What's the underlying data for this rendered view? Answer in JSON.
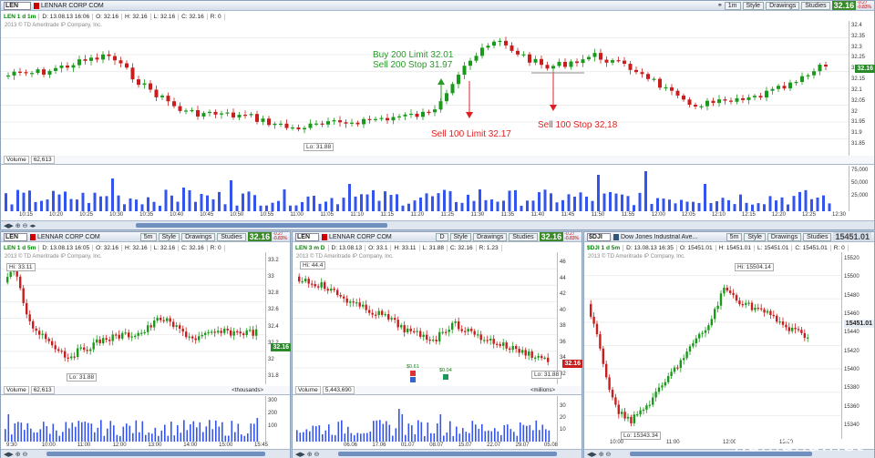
{
  "top": {
    "symbol": "LEN",
    "company": "LENNAR CORP COM",
    "interval_btn": "1m",
    "style_btn": "Style",
    "drawings_btn": "Drawings",
    "studies_btn": "Studies",
    "price": "32.16",
    "change": "-0.27",
    "change_pct": "-0.83%",
    "ohlc": [
      "LEN 1 d 1m",
      "D: 13.08.13 16:06",
      "O: 32.16",
      "H: 32.16",
      "L: 32.16",
      "C: 32.16",
      "R: 0"
    ],
    "copyright": "2013 © TD Ameritrade IP Company, Inc.",
    "yticks": [
      "32.4",
      "32.35",
      "32.3",
      "32.25",
      "32.2",
      "32.15",
      "32.1",
      "32.05",
      "32",
      "31.95",
      "31.9",
      "31.85"
    ],
    "price_label": "32.16",
    "low_label": "Lo: 31.88",
    "annotations": {
      "buy": "Buy 200 Limit 32.01",
      "sell_stop": "Sell 200 Stop 31.97",
      "sell_limit": "Sell 100 Limit 32.17",
      "sell_stop2": "Sell 100 Stop 32,18"
    },
    "volume_label": "Volume",
    "volume_value": "62,613",
    "vticks": [
      "75,000",
      "50,000",
      "25,000"
    ],
    "xticks": [
      "10:15",
      "10:20",
      "10:25",
      "10:30",
      "10:35",
      "10:40",
      "10:45",
      "10:50",
      "10:55",
      "11:00",
      "11:05",
      "11:10",
      "11:15",
      "11:20",
      "11:25",
      "11:30",
      "11:35",
      "11:40",
      "11:45",
      "11:50",
      "11:55",
      "12:00",
      "12:05",
      "12:10",
      "12:15",
      "12:20",
      "12:25",
      "12:30"
    ]
  },
  "bl": {
    "symbol": "LEN",
    "company": "LENNAR CORP COM",
    "interval_btn": "5m",
    "style_btn": "Style",
    "drawings_btn": "Drawings",
    "studies_btn": "Studies",
    "price": "32.16",
    "change": "-0.27",
    "change_pct": "-0.83%",
    "ohlc": [
      "LEN 1 d 5m",
      "D: 13.08.13 16:05",
      "O: 32.16",
      "H: 32.16",
      "L: 32.16",
      "C: 32.16",
      "R: 0"
    ],
    "copyright": "2013 © TD Ameritrade IP Company, Inc.",
    "hi_label": "Hi: 33.11",
    "lo_label": "Lo: 31.88",
    "yticks": [
      "33.2",
      "33",
      "32.8",
      "32.6",
      "32.4",
      "32.2",
      "32",
      "31.8"
    ],
    "price_label": "32.16",
    "volume_label": "Volume",
    "volume_value": "62,613",
    "volume_units": "<thousands>",
    "vticks": [
      "300",
      "200",
      "100"
    ],
    "xticks": [
      "9:30",
      "10:00",
      "11:00",
      "12:00",
      "13:00",
      "14:00",
      "15:00",
      "15:45"
    ]
  },
  "bm": {
    "symbol": "LEN",
    "company": "LENNAR CORP COM",
    "interval_btn": "D",
    "style_btn": "Style",
    "drawings_btn": "Drawings",
    "studies_btn": "Studies",
    "price": "32.16",
    "change": "-0.27",
    "change_pct": "-0.83%",
    "ohlc": [
      "LEN 3 m D",
      "D: 13.08.13",
      "O: 33.1",
      "H: 33.11",
      "L: 31.88",
      "C: 32.16",
      "R: 1.23"
    ],
    "copyright": "2013 © TD Ameritrade IP Company, Inc.",
    "hi_label": "Hi: 44.4",
    "lo_label": "Lo: 31.88",
    "div1": "$0.61",
    "div2": "$0.04",
    "yticks": [
      "46",
      "44",
      "42",
      "40",
      "38",
      "36",
      "34",
      "32"
    ],
    "price_label": "32.16",
    "volume_label": "Volume",
    "volume_value": "5,443,690",
    "volume_units": "<millions>",
    "vticks": [
      "30",
      "20",
      "10"
    ],
    "xticks": [
      "06.06",
      "17.06",
      "01.07",
      "08.07",
      "15.07",
      "22.07",
      "29.07",
      "05.08"
    ]
  },
  "br": {
    "symbol": "$DJI",
    "company": "Dow Jones Industrial Ave...",
    "interval_btn": "5m",
    "style_btn": "Style",
    "drawings_btn": "Drawings",
    "studies_btn": "Studies",
    "price": "15451.01",
    "ohlc": [
      "$DJI 1 d 5m",
      "D: 13.08.13 16:35",
      "O: 15451.01",
      "H: 15451.01",
      "L: 15451.01",
      "C: 15451.01",
      "R: 0"
    ],
    "copyright": "2013 © TD Ameritrade IP Company, Inc.",
    "hi_label": "Hi: 15504.14",
    "lo_label": "Lo: 15343.34",
    "yticks": [
      "15520",
      "15500",
      "15480",
      "15460",
      "15440",
      "15420",
      "15400",
      "15380",
      "15360",
      "15340"
    ],
    "price_label": "15451.01",
    "xticks": [
      "10:00",
      "11:00",
      "12:00",
      "13:00"
    ]
  },
  "watermark": "hamaha.net",
  "colors": {
    "up": "#1a9a1a",
    "down": "#c81e1e",
    "volume": "#3354ee",
    "buy_text": "#2a9a2a",
    "sell_text": "#e02020"
  }
}
